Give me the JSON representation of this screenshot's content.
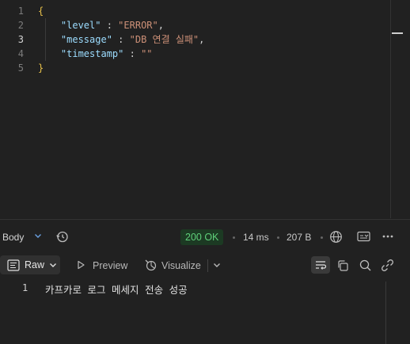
{
  "editor": {
    "line_numbers": [
      "1",
      "2",
      "3",
      "4",
      "5"
    ],
    "lines": [
      {
        "open": "{"
      },
      {
        "key": "\"level\"",
        "sep": " : ",
        "value": "\"ERROR\"",
        "tail": ","
      },
      {
        "key": "\"message\"",
        "sep": " : ",
        "value": "\"DB 연결 실패\"",
        "tail": ","
      },
      {
        "key": "\"timestamp\"",
        "sep": " : ",
        "value": "\"\"",
        "tail": ""
      },
      {
        "close": "}"
      }
    ]
  },
  "response_bar": {
    "body_tab": "Body",
    "status": "200 OK",
    "time": "14 ms",
    "size": "207 B",
    "status_color": "#5fd07a"
  },
  "view_bar": {
    "raw_label": "Raw",
    "preview_label": "Preview",
    "visualize_label": "Visualize"
  },
  "response_body": {
    "line_number": "1",
    "text": "카프카로 로그 메세지 전송 성공"
  }
}
